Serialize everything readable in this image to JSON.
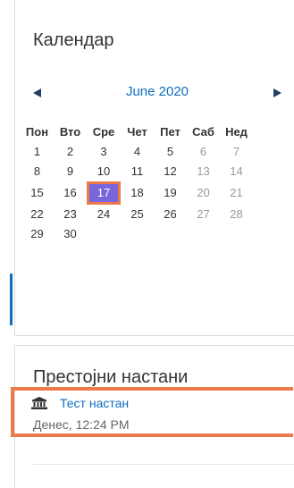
{
  "calendar": {
    "title": "Календар",
    "month_label": "June 2020",
    "weekdays": [
      "Пон",
      "Вто",
      "Сре",
      "Чет",
      "Пет",
      "Саб",
      "Нед"
    ],
    "weeks": [
      [
        "1",
        "2",
        "3",
        "4",
        "5",
        "6",
        "7"
      ],
      [
        "8",
        "9",
        "10",
        "11",
        "12",
        "13",
        "14"
      ],
      [
        "15",
        "16",
        "17",
        "18",
        "19",
        "20",
        "21"
      ],
      [
        "22",
        "23",
        "24",
        "25",
        "26",
        "27",
        "28"
      ],
      [
        "29",
        "30",
        "",
        "",
        "",
        "",
        ""
      ]
    ],
    "today": "17",
    "prev_icon": "triangle-left-icon",
    "next_icon": "triangle-right-icon"
  },
  "upcoming": {
    "title": "Престојни настани",
    "event": {
      "icon": "institution-icon",
      "name": "Тест настан",
      "time": "Денес, 12:24 PM"
    }
  },
  "colors": {
    "link": "#0f6cbf",
    "today_bg": "#7a66dc",
    "highlight": "#ec7b4b",
    "weekend": "#9a9a9a"
  }
}
